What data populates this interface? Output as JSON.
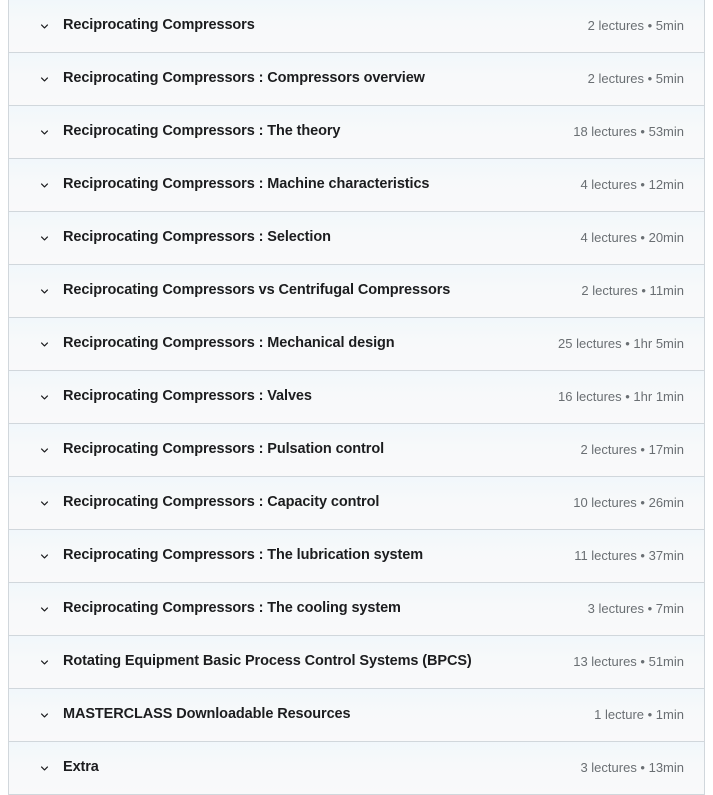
{
  "curriculum": {
    "chevron_icon": "chevron-down-icon",
    "colors": {
      "title_text": "#1c1d1f",
      "meta_text": "#6a6f73",
      "border": "#d1d7dc",
      "row_background_top": "#f1f7fb",
      "row_background_bottom": "#f9f9fa"
    },
    "sections": [
      {
        "title": "Reciprocating Compressors",
        "meta": "2 lectures • 5min",
        "lectures": 2,
        "duration": "5min"
      },
      {
        "title": "Reciprocating Compressors : Compressors overview",
        "meta": "2 lectures • 5min",
        "lectures": 2,
        "duration": "5min"
      },
      {
        "title": "Reciprocating Compressors : The theory",
        "meta": "18 lectures • 53min",
        "lectures": 18,
        "duration": "53min"
      },
      {
        "title": "Reciprocating Compressors : Machine characteristics",
        "meta": "4 lectures • 12min",
        "lectures": 4,
        "duration": "12min"
      },
      {
        "title": "Reciprocating Compressors : Selection",
        "meta": "4 lectures • 20min",
        "lectures": 4,
        "duration": "20min"
      },
      {
        "title": "Reciprocating Compressors vs Centrifugal Compressors",
        "meta": "2 lectures • 11min",
        "lectures": 2,
        "duration": "11min"
      },
      {
        "title": "Reciprocating Compressors : Mechanical design",
        "meta": "25 lectures • 1hr 5min",
        "lectures": 25,
        "duration": "1hr 5min"
      },
      {
        "title": "Reciprocating Compressors : Valves",
        "meta": "16 lectures • 1hr 1min",
        "lectures": 16,
        "duration": "1hr 1min"
      },
      {
        "title": "Reciprocating Compressors : Pulsation control",
        "meta": "2 lectures • 17min",
        "lectures": 2,
        "duration": "17min"
      },
      {
        "title": "Reciprocating Compressors : Capacity control",
        "meta": "10 lectures • 26min",
        "lectures": 10,
        "duration": "26min"
      },
      {
        "title": "Reciprocating Compressors : The lubrication system",
        "meta": "11 lectures • 37min",
        "lectures": 11,
        "duration": "37min"
      },
      {
        "title": "Reciprocating Compressors : The cooling system",
        "meta": "3 lectures • 7min",
        "lectures": 3,
        "duration": "7min"
      },
      {
        "title": "Rotating Equipment Basic Process Control Systems (BPCS)",
        "meta": "13 lectures • 51min",
        "lectures": 13,
        "duration": "51min"
      },
      {
        "title": "MASTERCLASS Downloadable Resources",
        "meta": "1 lecture • 1min",
        "lectures": 1,
        "duration": "1min"
      },
      {
        "title": "Extra",
        "meta": "3 lectures • 13min",
        "lectures": 3,
        "duration": "13min"
      }
    ]
  }
}
